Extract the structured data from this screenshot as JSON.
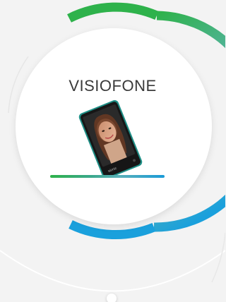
{
  "card": {
    "title": "VISIOFONE"
  },
  "progress": {
    "fraction": 1.0
  },
  "phone": {
    "brand": "sionic",
    "body_color": "#1f8f86",
    "screen_color": "#2a2a2a"
  },
  "colors": {
    "ring_start": "#2eb24b",
    "ring_mid": "#5ab4a8",
    "ring_end": "#1aa0dc",
    "background": "#f3f3f3"
  },
  "icons": {
    "device": "smartphone-icon"
  }
}
